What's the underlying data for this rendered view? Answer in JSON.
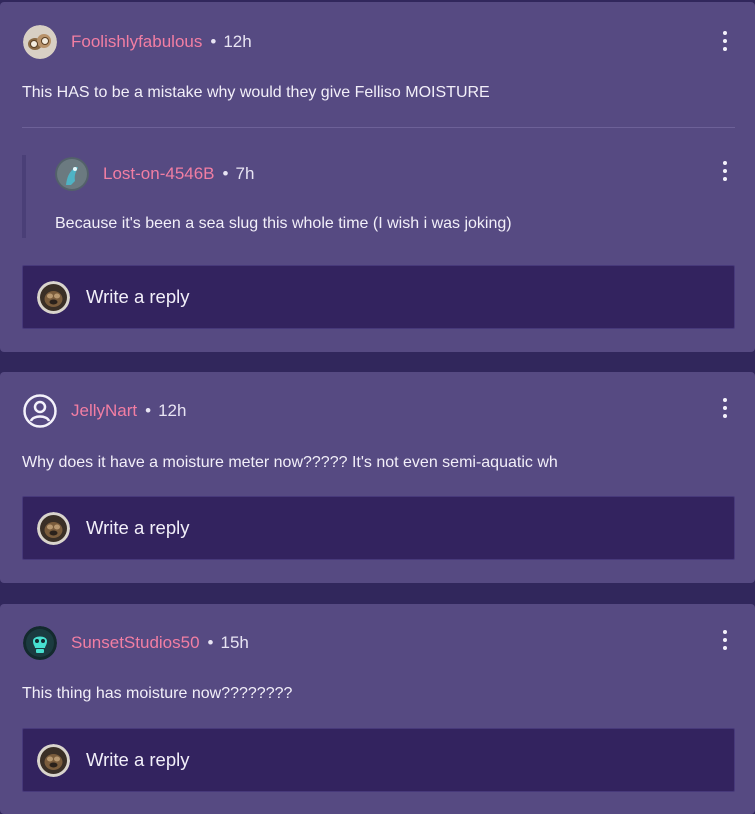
{
  "comments": [
    {
      "username": "Foolishlyfabulous",
      "time": "12h",
      "text": "This HAS to be a mistake why would they give Felliso MOISTURE",
      "avatar_icon": "pet-avatar-icon",
      "replies": [
        {
          "username": "Lost-on-4546B",
          "time": "7h",
          "text": "Because it's been a sea slug this whole time (I wish i was joking)",
          "avatar_icon": "pet-avatar-icon"
        }
      ]
    },
    {
      "username": "JellyNart",
      "time": "12h",
      "text": "Why does it have a moisture meter now????? It's not even semi-aquatic wh",
      "avatar_icon": "default-user-icon"
    },
    {
      "username": "SunsetStudios50",
      "time": "15h",
      "text": "This thing has moisture now????????",
      "avatar_icon": "skull-avatar-icon"
    }
  ],
  "reply_placeholder": "Write a reply",
  "separator": "•",
  "colors": {
    "page_background": "#31275c",
    "card_background": "#564a82",
    "reply_box_background": "#33235f",
    "username": "#f27ea3",
    "text": "#f2eff9"
  }
}
